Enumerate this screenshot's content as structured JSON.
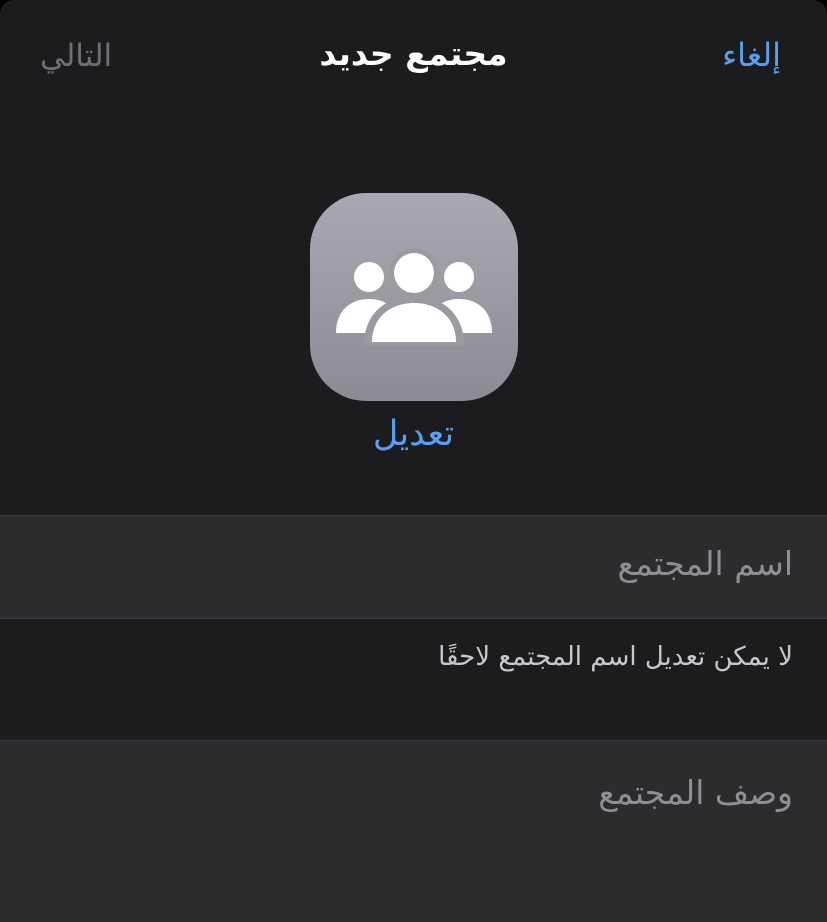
{
  "nav": {
    "cancel_label": "إلغاء",
    "title": "مجتمع جديد",
    "next_label": "التالي"
  },
  "avatar": {
    "icon": "group-icon",
    "edit_label": "تعديل"
  },
  "form": {
    "name_placeholder": "اسم المجتمع",
    "name_helper": "لا يمكن تعديل اسم المجتمع لاحقًا",
    "description_placeholder": "وصف المجتمع"
  },
  "colors": {
    "accent": "#5a9ff2",
    "background": "#1c1c1e",
    "field_background": "#2c2c2e",
    "disabled_text": "#6f6f75",
    "placeholder_text": "#8e8e93"
  }
}
